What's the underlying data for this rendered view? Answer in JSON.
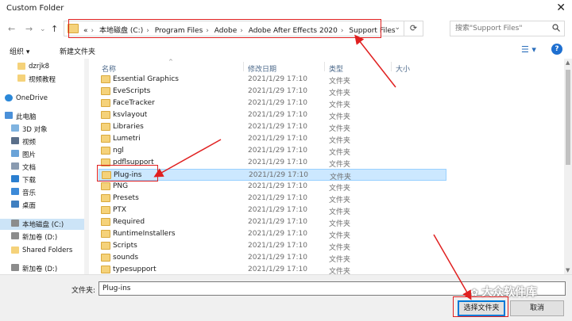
{
  "window": {
    "title": "Custom Folder",
    "close_glyph": "✕"
  },
  "nav": {
    "back": "←",
    "forward": "→",
    "recent": "⌄",
    "up": "↑"
  },
  "address": {
    "overflow": "«",
    "crumbs": [
      "本地磁盘 (C:)",
      "Program Files",
      "Adobe",
      "Adobe After Effects 2020",
      "Support Files"
    ],
    "separator": "›",
    "dropdown": "⌄",
    "refresh": "⟳"
  },
  "search": {
    "placeholder": "搜索\"Support Files\"",
    "icon": "search-icon"
  },
  "toolbar": {
    "organize": "组织 ▾",
    "new_folder": "新建文件夹",
    "view": "☰ ▾",
    "help": "?"
  },
  "sidebar": {
    "items": [
      {
        "label": "dzrjk8",
        "icon": "folder-icon"
      },
      {
        "label": "视频教程",
        "icon": "folder-icon"
      },
      {
        "label": "OneDrive",
        "icon": "cloud-icon"
      },
      {
        "label": "此电脑",
        "icon": "computer-icon"
      },
      {
        "label": "3D 对象",
        "icon": "cube-icon"
      },
      {
        "label": "视频",
        "icon": "video-icon"
      },
      {
        "label": "图片",
        "icon": "picture-icon"
      },
      {
        "label": "文档",
        "icon": "document-icon"
      },
      {
        "label": "下载",
        "icon": "download-icon"
      },
      {
        "label": "音乐",
        "icon": "music-icon"
      },
      {
        "label": "桌面",
        "icon": "desktop-icon"
      },
      {
        "label": "本地磁盘 (C:)",
        "icon": "drive-icon"
      },
      {
        "label": "新加卷 (D:)",
        "icon": "drive-icon"
      },
      {
        "label": "Shared Folders",
        "icon": "folder-icon"
      },
      {
        "label": "新加卷 (D:)",
        "icon": "drive-icon"
      }
    ]
  },
  "columns": {
    "name": "名称",
    "modified": "修改日期",
    "type": "类型",
    "size": "大小",
    "sort_glyph": "^"
  },
  "files": [
    {
      "name": "Essential Graphics",
      "date": "2021/1/29 17:10",
      "type": "文件夹"
    },
    {
      "name": "EveScripts",
      "date": "2021/1/29 17:10",
      "type": "文件夹"
    },
    {
      "name": "FaceTracker",
      "date": "2021/1/29 17:10",
      "type": "文件夹"
    },
    {
      "name": "ksvlayout",
      "date": "2021/1/29 17:10",
      "type": "文件夹"
    },
    {
      "name": "Libraries",
      "date": "2021/1/29 17:10",
      "type": "文件夹"
    },
    {
      "name": "Lumetri",
      "date": "2021/1/29 17:10",
      "type": "文件夹"
    },
    {
      "name": "ngl",
      "date": "2021/1/29 17:10",
      "type": "文件夹"
    },
    {
      "name": "pdflsupport",
      "date": "2021/1/29 17:10",
      "type": "文件夹"
    },
    {
      "name": "Plug-ins",
      "date": "2021/1/29 17:10",
      "type": "文件夹",
      "selected": true
    },
    {
      "name": "PNG",
      "date": "2021/1/29 17:10",
      "type": "文件夹"
    },
    {
      "name": "Presets",
      "date": "2021/1/29 17:10",
      "type": "文件夹"
    },
    {
      "name": "PTX",
      "date": "2021/1/29 17:10",
      "type": "文件夹"
    },
    {
      "name": "Required",
      "date": "2021/1/29 17:10",
      "type": "文件夹"
    },
    {
      "name": "RuntimeInstallers",
      "date": "2021/1/29 17:10",
      "type": "文件夹"
    },
    {
      "name": "Scripts",
      "date": "2021/1/29 17:10",
      "type": "文件夹"
    },
    {
      "name": "sounds",
      "date": "2021/1/29 17:10",
      "type": "文件夹"
    },
    {
      "name": "typesupport",
      "date": "2021/1/29 17:10",
      "type": "文件夹"
    }
  ],
  "bottom": {
    "filename_label": "文件夹:",
    "filename_value": "Plug-ins",
    "select_button": "选择文件夹",
    "cancel_button": "取消"
  },
  "watermark": {
    "text": "大众软件库",
    "glyph": "✿"
  },
  "colors": {
    "annotation_red": "#e02020",
    "selection_blue": "#cce8ff",
    "folder_yellow": "#f5d27a"
  }
}
